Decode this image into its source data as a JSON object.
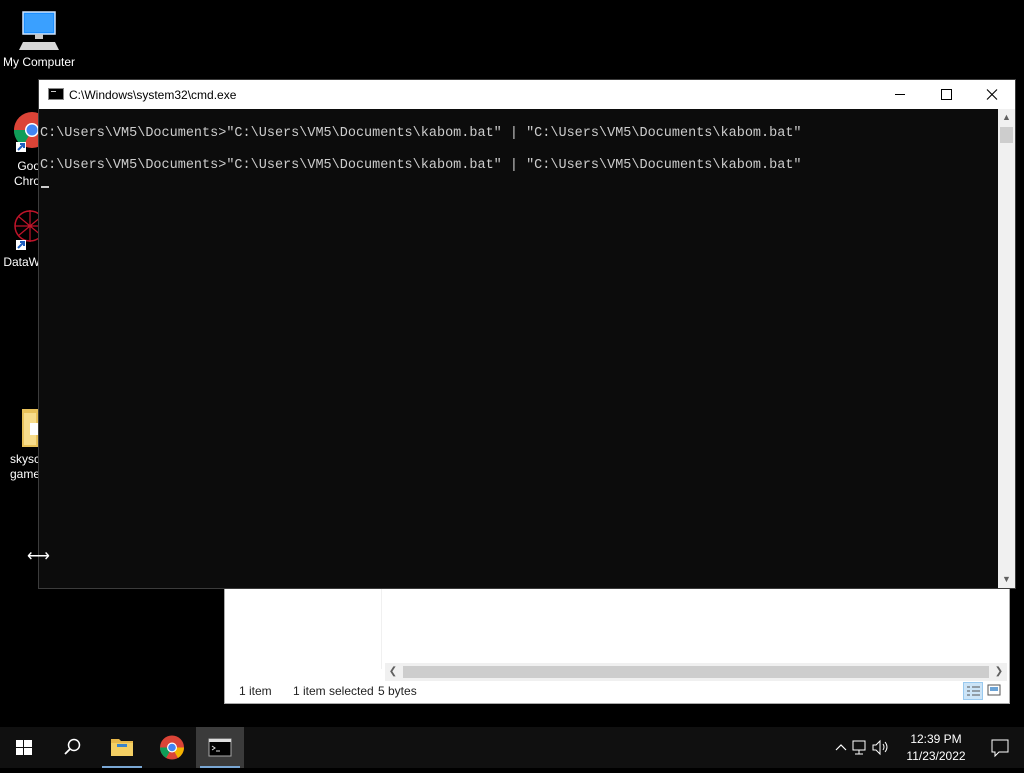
{
  "desktop": {
    "icons": [
      {
        "label": "My Computer"
      },
      {
        "label": "Goo\nChro"
      },
      {
        "label": "DataW"
      },
      {
        "label": "skysc\ngame"
      }
    ]
  },
  "explorer": {
    "status_items": "1 item",
    "status_selected": "1 item selected",
    "status_size": "5 bytes"
  },
  "cmd": {
    "title": "C:\\Windows\\system32\\cmd.exe",
    "lines": [
      "C:\\Users\\VM5\\Documents>\"C:\\Users\\VM5\\Documents\\kabom.bat\" | \"C:\\Users\\VM5\\Documents\\kabom.bat\"",
      "C:\\Users\\VM5\\Documents>\"C:\\Users\\VM5\\Documents\\kabom.bat\" | \"C:\\Users\\VM5\\Documents\\kabom.bat\""
    ]
  },
  "taskbar": {
    "clock_time": "12:39 PM",
    "clock_date": "11/23/2022",
    "icons": [
      "windows-start-icon",
      "search-icon",
      "file-explorer-icon",
      "chrome-icon",
      "cmd-icon"
    ]
  },
  "colors": {
    "cmd_bg": "#0c0c0c",
    "cmd_text": "#cccccc",
    "taskbar": "#101010"
  }
}
